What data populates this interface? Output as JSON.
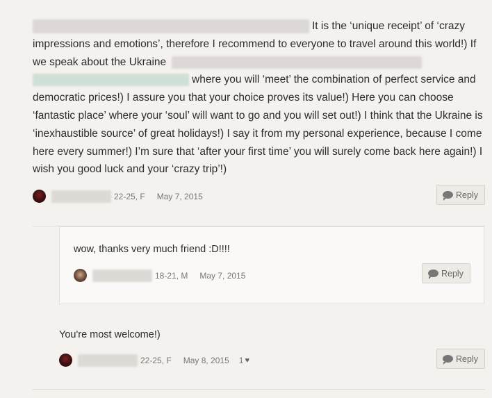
{
  "post": {
    "segments": [
      "It is the ‘unique receipt’ of ‘crazy impressions and emotions’, therefore I recommend to everyone to travel around this world!) If we speak about the Ukraine",
      "where you will ‘meet’ the combination of perfect service and democratic prices!) I assure you that your choice proves its value!) Here you can choose ‘fantastic place’ where your ‘soul’ will want to go and you will set out!) I think that the Ukraine is ‘inexhaustible source’ of great holidays!) I say it from my personal experience, because I come here every summer!) I’m sure that ‘after your first time’ you will surely come back here again!) I wish you good luck and your ‘crazy trip’!)"
    ],
    "age_gender": "22-25, F",
    "date": "May 7, 2015",
    "reply_label": "Reply"
  },
  "comments": [
    {
      "text": "wow, thanks very much friend :D!!!!",
      "age_gender": "18-21, M",
      "date": "May 7, 2015",
      "reply_label": "Reply"
    },
    {
      "text": "You're most welcome!)",
      "age_gender": "22-25, F",
      "date": "May 8, 2015",
      "likes": "1",
      "reply_label": "Reply"
    }
  ],
  "icons": [
    "reply-bubble-icon",
    "heart-icon",
    "avatar"
  ]
}
